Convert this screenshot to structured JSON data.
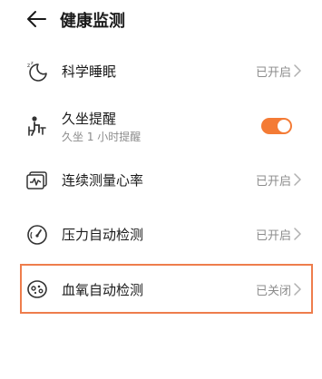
{
  "header": {
    "title": "健康监测"
  },
  "items": [
    {
      "label": "科学睡眠",
      "status": "已开启",
      "icon": "sleep-moon-icon"
    },
    {
      "label": "久坐提醒",
      "sub": "久坐 1 小时提醒",
      "toggle_on": true,
      "icon": "sedentary-icon"
    },
    {
      "label": "连续测量心率",
      "status": "已开启",
      "icon": "heart-rate-icon"
    },
    {
      "label": "压力自动检测",
      "status": "已开启",
      "icon": "pressure-gauge-icon"
    },
    {
      "label": "血氧自动检测",
      "status": "已关闭",
      "icon": "blood-oxygen-icon",
      "highlighted": true
    }
  ],
  "colors": {
    "accent": "#f47b35",
    "highlight_border": "#ee7d4c",
    "secondary_text": "#8c8c8c"
  }
}
